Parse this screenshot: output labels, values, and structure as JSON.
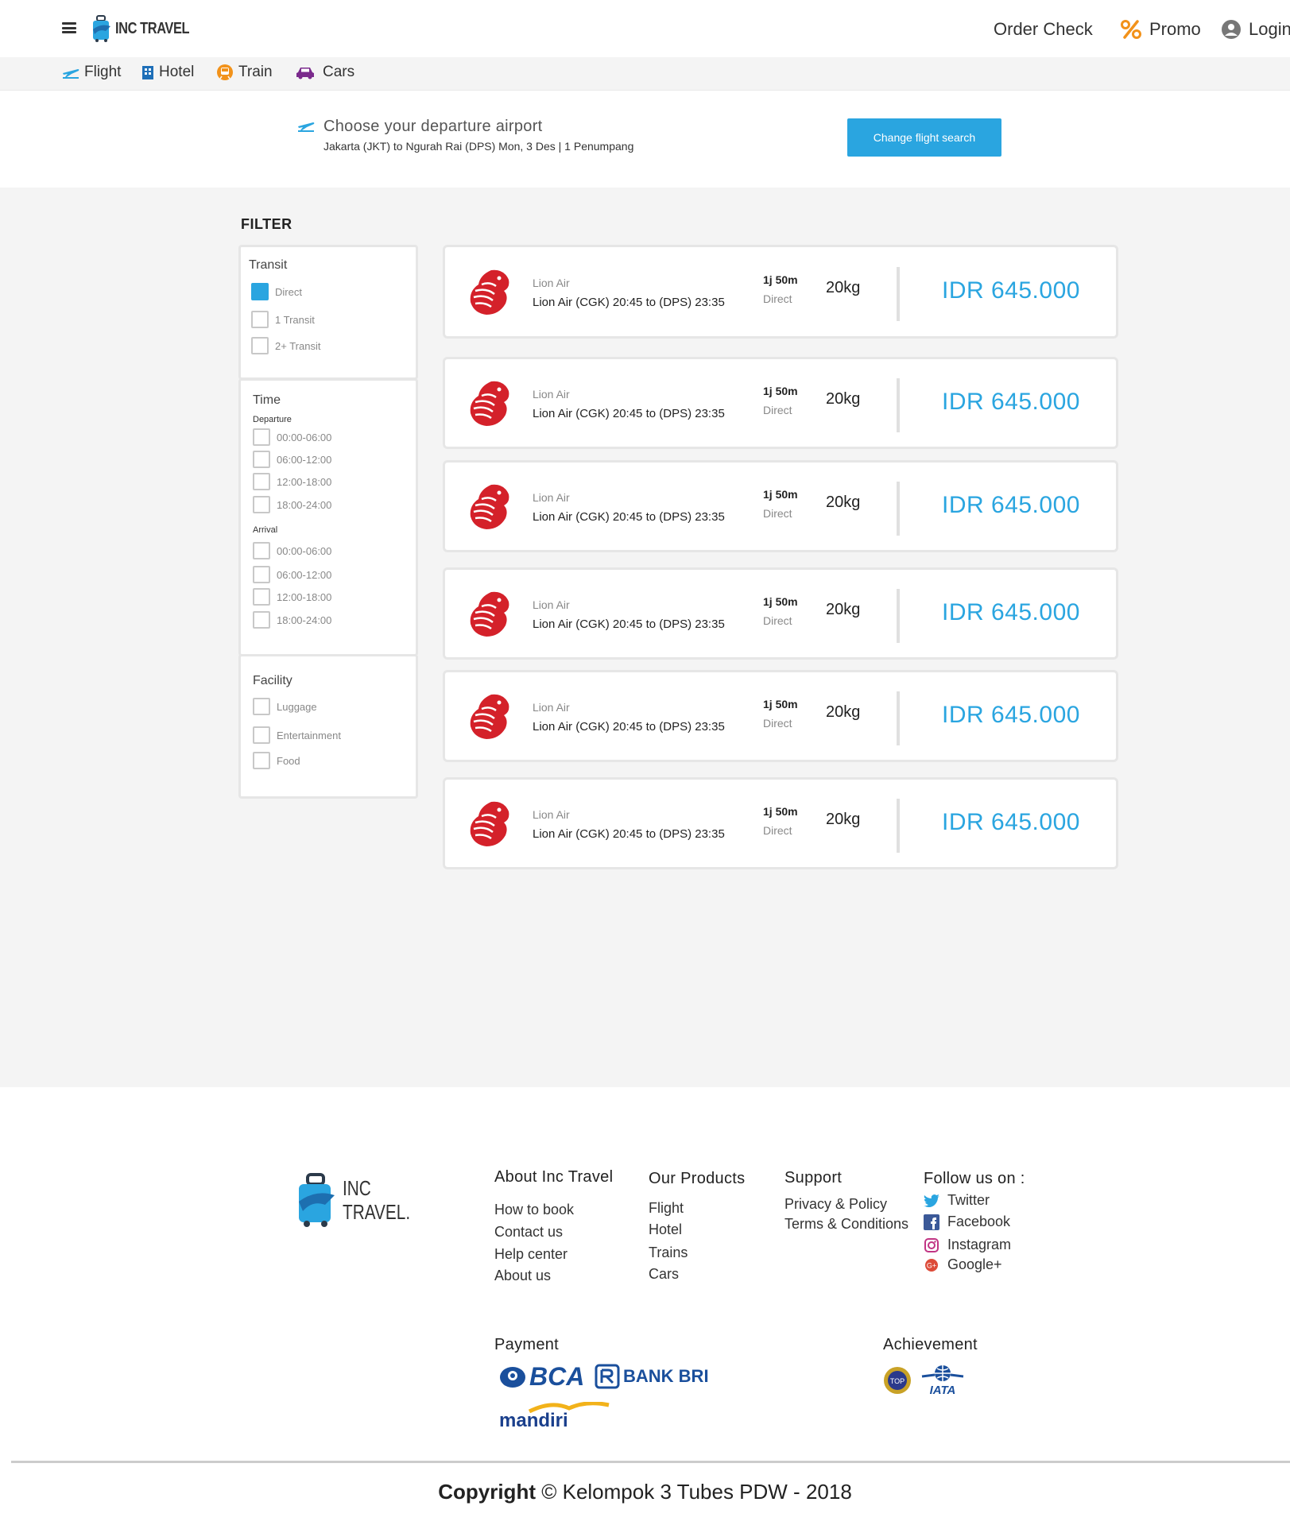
{
  "header": {
    "brand": "INC TRAVEL",
    "order_check": "Order Check",
    "promo": "Promo",
    "login": "Login"
  },
  "subnav": {
    "items": [
      {
        "label": "Flight",
        "icon": "plane-icon",
        "color": "#2aa5e0"
      },
      {
        "label": "Hotel",
        "icon": "building-icon",
        "color": "#1e6fb8"
      },
      {
        "label": "Train",
        "icon": "train-icon",
        "color": "#f2921a"
      },
      {
        "label": "Cars",
        "icon": "car-icon",
        "color": "#7a2a8c"
      }
    ]
  },
  "search_summary": {
    "title": "Choose your departure airport",
    "subtitle": "Jakarta (JKT) to Ngurah Rai (DPS) Mon, 3 Des | 1 Penumpang",
    "change_button": "Change flight search"
  },
  "filter": {
    "title": "FILTER",
    "transit": {
      "heading": "Transit",
      "options": [
        {
          "label": "Direct",
          "checked": true
        },
        {
          "label": "1 Transit",
          "checked": false
        },
        {
          "label": "2+ Transit",
          "checked": false
        }
      ]
    },
    "time": {
      "heading": "Time",
      "departure_label": "Departure",
      "departure": [
        "00:00-06:00",
        "06:00-12:00",
        "12:00-18:00",
        "18:00-24:00"
      ],
      "arrival_label": "Arrival",
      "arrival": [
        "00:00-06:00",
        "06:00-12:00",
        "12:00-18:00",
        "18:00-24:00"
      ]
    },
    "facility": {
      "heading": "Facility",
      "options": [
        "Luggage",
        "Entertainment",
        "Food"
      ]
    }
  },
  "flights": [
    {
      "airline": "Lion Air",
      "route": "Lion Air (CGK) 20:45 to (DPS) 23:35",
      "duration": "1j 50m",
      "type": "Direct",
      "baggage": "20kg",
      "price": "IDR 645.000"
    },
    {
      "airline": "Lion Air",
      "route": "Lion Air (CGK) 20:45 to (DPS) 23:35",
      "duration": "1j 50m",
      "type": "Direct",
      "baggage": "20kg",
      "price": "IDR 645.000"
    },
    {
      "airline": "Lion Air",
      "route": "Lion Air (CGK) 20:45 to (DPS) 23:35",
      "duration": "1j 50m",
      "type": "Direct",
      "baggage": "20kg",
      "price": "IDR 645.000"
    },
    {
      "airline": "Lion Air",
      "route": "Lion Air (CGK) 20:45 to (DPS) 23:35",
      "duration": "1j 50m",
      "type": "Direct",
      "baggage": "20kg",
      "price": "IDR 645.000"
    },
    {
      "airline": "Lion Air",
      "route": "Lion Air (CGK) 20:45 to (DPS) 23:35",
      "duration": "1j 50m",
      "type": "Direct",
      "baggage": "20kg",
      "price": "IDR 645.000"
    },
    {
      "airline": "Lion Air",
      "route": "Lion Air (CGK) 20:45 to (DPS) 23:35",
      "duration": "1j 50m",
      "type": "Direct",
      "baggage": "20kg",
      "price": "IDR 645.000"
    }
  ],
  "footer": {
    "brand_line1": "INC",
    "brand_line2": "TRAVEL.",
    "about": {
      "title": "About Inc Travel",
      "links": [
        "How to book",
        "Contact us",
        "Help center",
        "About us"
      ]
    },
    "products": {
      "title": "Our Products",
      "links": [
        "Flight",
        "Hotel",
        "Trains",
        "Cars"
      ]
    },
    "support": {
      "title": "Support",
      "links": [
        "Privacy & Policy",
        "Terms & Conditions"
      ]
    },
    "follow": {
      "title": "Follow us on :",
      "links": [
        "Twitter",
        "Facebook",
        "Instagram",
        "Google+"
      ]
    },
    "payment": {
      "title": "Payment",
      "logos": [
        "BCA",
        "BANK BRI",
        "mandiri"
      ]
    },
    "achievement": {
      "title": "Achievement",
      "logos": [
        "TOP",
        "IATA"
      ]
    },
    "copyright_bold": "Copyright",
    "copyright_rest": "© Kelompok 3 Tubes PDW - 2018"
  },
  "colors": {
    "accent": "#2aa5e0",
    "lion_red": "#d4212a",
    "promo": "#f2921a"
  }
}
